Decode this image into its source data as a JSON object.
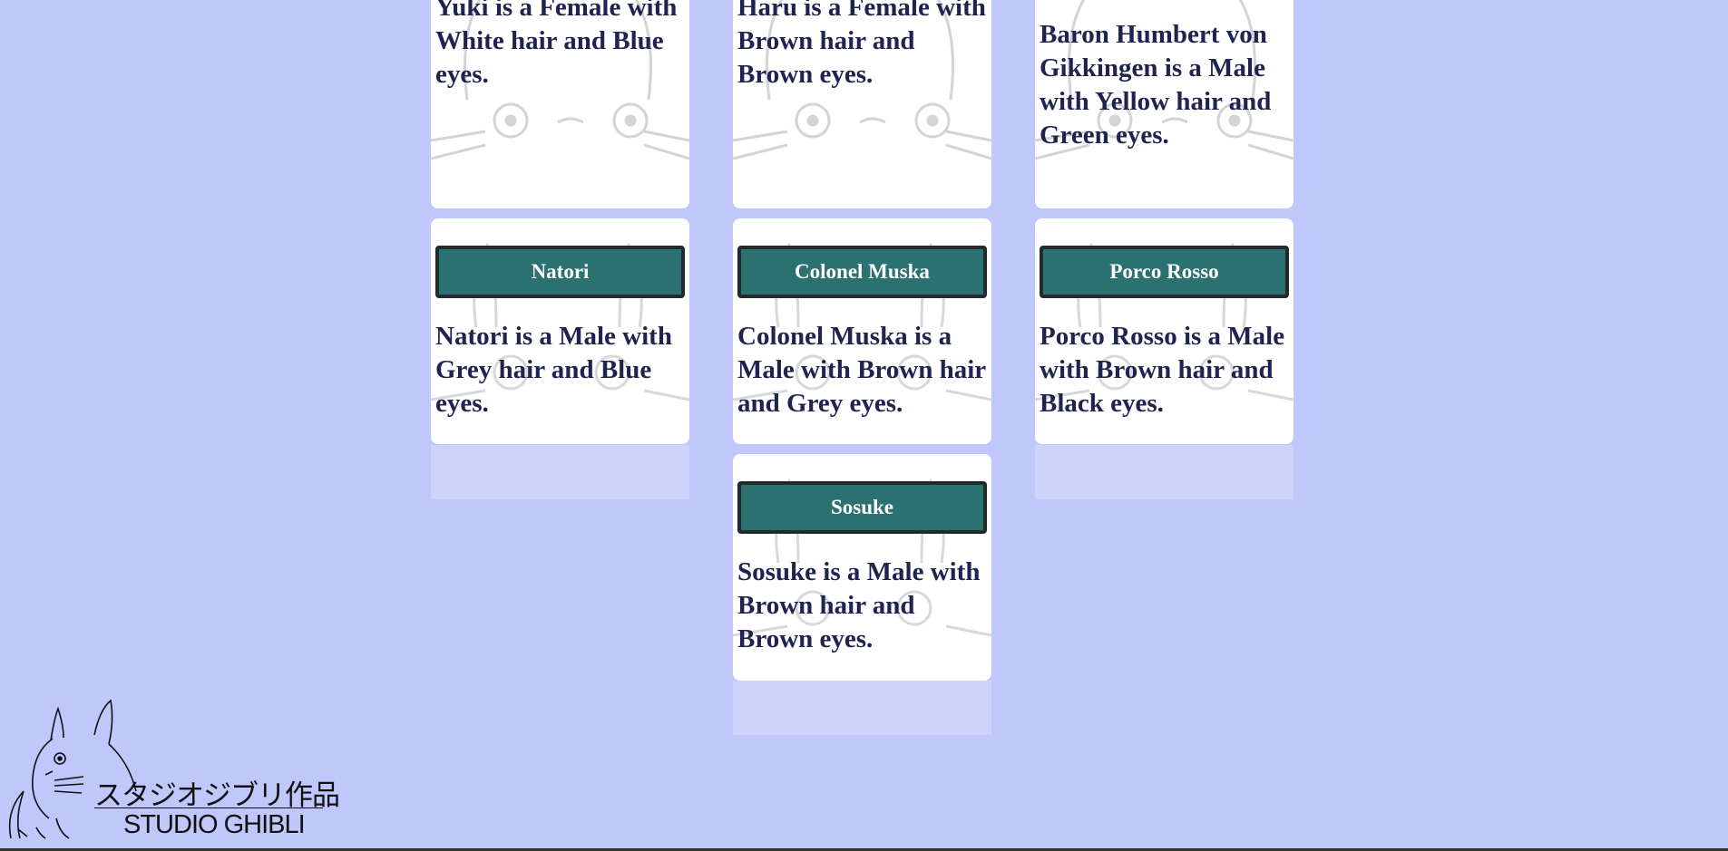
{
  "cards": [
    {
      "name": "",
      "description": "Yuki is a Female with White hair and Blue eyes."
    },
    {
      "name": "",
      "description": "Haru is a Female with Brown hair and Brown eyes."
    },
    {
      "name": "",
      "description": "Baron Humbert von Gikkingen is a Male with Yellow hair and Green eyes."
    },
    {
      "name": "Natori",
      "description": "Natori is a Male with Grey hair and Blue eyes."
    },
    {
      "name": "Colonel Muska",
      "description": "Colonel Muska is a Male with Brown hair and Grey eyes."
    },
    {
      "name": "Porco Rosso",
      "description": "Porco Rosso is a Male with Brown hair and Black eyes."
    },
    {
      "name": "Sosuke",
      "description": "Sosuke is a Male with Brown hair and Brown eyes."
    }
  ],
  "logo": {
    "japanese": "スタジオジブリ作品",
    "english": "STUDIO GHIBLI"
  },
  "colors": {
    "background": "#c0c8fb",
    "card": "#ffffff",
    "button": "#2b7171",
    "text": "#1e2350"
  }
}
